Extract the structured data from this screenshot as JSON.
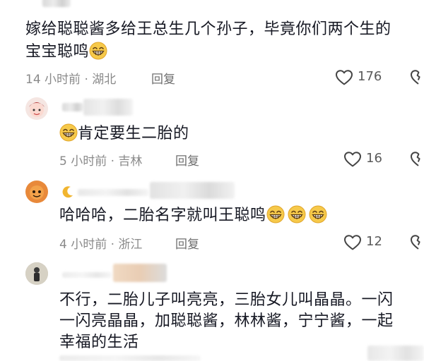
{
  "comments": [
    {
      "text_line1": "嫁给聪聪酱多给王总生几个孙子，毕竟你们两个生的",
      "text_line2": "宝宝聪鸣",
      "time_location": "14 小时前 · 湖北",
      "reply_label": "回复",
      "like_count": "176"
    },
    {
      "text": "肯定要生二胎的",
      "time_location": "5 小时前 · 吉林",
      "reply_label": "回复",
      "like_count": "16"
    },
    {
      "text": "哈哈哈，二胎名字就叫王聪鸣",
      "time_location": "4 小时前 · 浙江",
      "reply_label": "回复",
      "like_count": "12"
    },
    {
      "text_line1": "不行，二胎儿子叫亮亮，三胎女儿叫晶晶。一闪",
      "text_line2": "一闪亮晶晶，加聪聪酱，林林酱，宁宁酱，一起",
      "text_line3": "幸福的生活"
    }
  ],
  "icons": {
    "like": "heart-outline-icon",
    "dislike": "broken-heart-icon",
    "emoji": "grinning-emoji-icon"
  },
  "colors": {
    "text": "#161823",
    "meta": "#8a8a8a",
    "emoji_face": "#f6c94a"
  }
}
